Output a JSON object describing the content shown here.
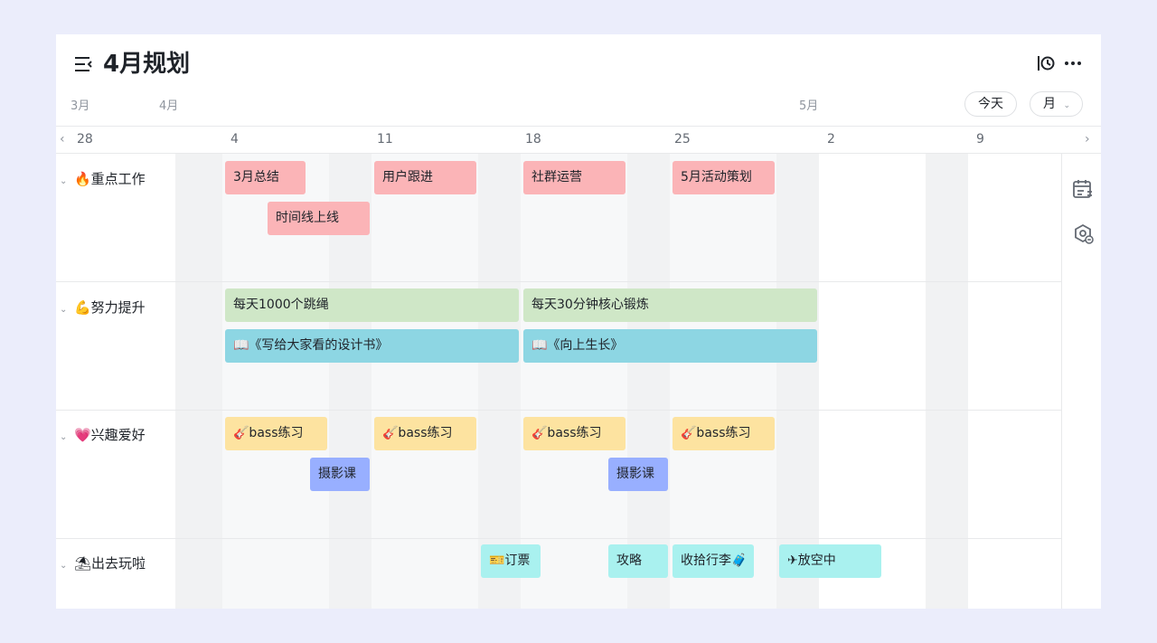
{
  "header": {
    "title": "4月规划",
    "today_label": "今天",
    "view_label": "月",
    "months": [
      "3月",
      "4月",
      "5月"
    ]
  },
  "date_labels": [
    "28",
    "4",
    "11",
    "18",
    "25",
    "2",
    "9"
  ],
  "groups": [
    {
      "label": "🔥重点工作",
      "tasks": [
        "3月总结",
        "用户跟进",
        "社群运营",
        "5月活动策划",
        "时间线上线"
      ]
    },
    {
      "label": "💪努力提升",
      "tasks": [
        "每天1000个跳绳",
        "每天30分钟核心锻炼",
        "📖《写给大家看的设计书》",
        "📖《向上生长》"
      ]
    },
    {
      "label": "💗兴趣爱好",
      "tasks": [
        "🎸bass练习",
        "🎸bass练习",
        "🎸bass练习",
        "🎸bass练习",
        "摄影课",
        "摄影课"
      ]
    },
    {
      "label": "⛱出去玩啦",
      "tasks": [
        "🎫订票",
        "攻略",
        "收拾行李🧳",
        "✈放空中"
      ]
    }
  ],
  "colors": {
    "work": "#fbb4b7",
    "improve_green": "#cfe7c7",
    "improve_blue": "#8dd6e3",
    "hobby_yellow": "#fde3a0",
    "hobby_purple": "#98afff",
    "travel": "#a9f1ef",
    "background": "#ebedfb"
  },
  "icons": [
    "menu-collapse-icon",
    "timeline-settings-icon",
    "more-icon",
    "calendar-list-icon",
    "settings-badge-icon",
    "chevron-down-icon",
    "chevron-left-icon",
    "chevron-right-icon"
  ]
}
